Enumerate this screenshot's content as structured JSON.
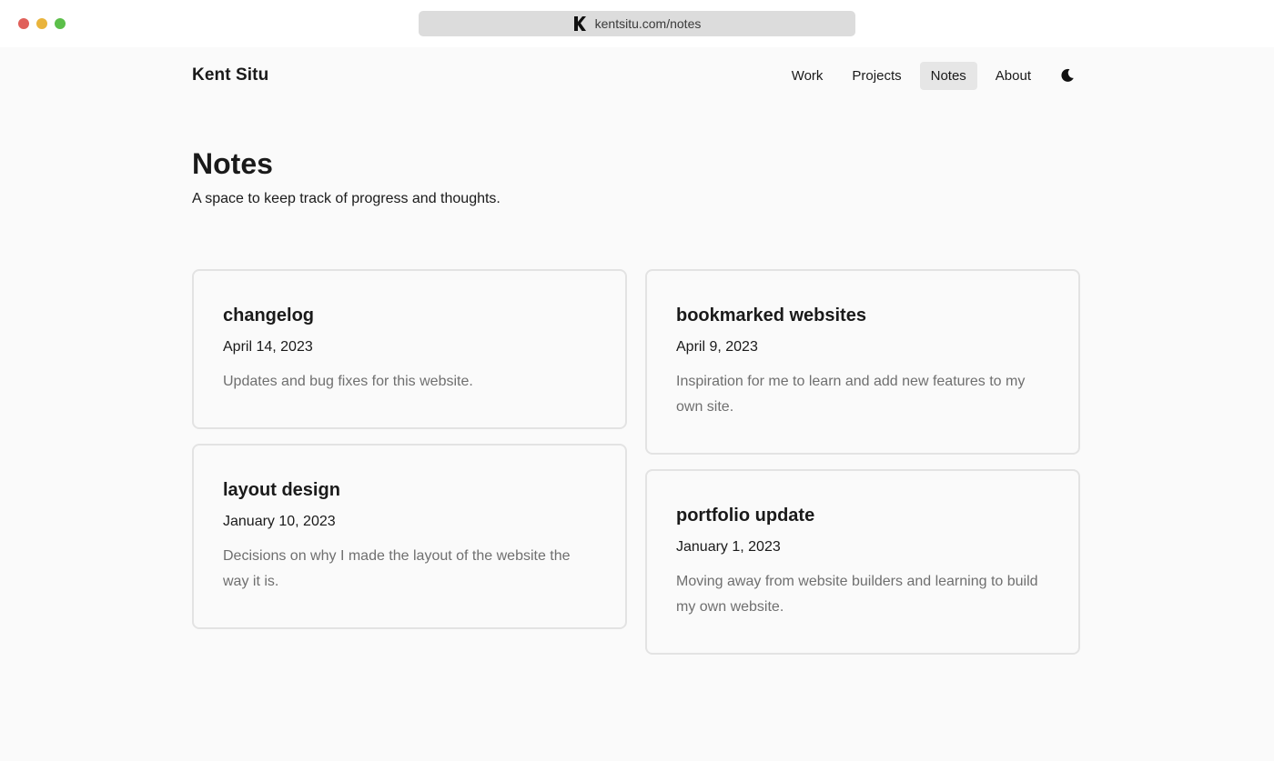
{
  "browser": {
    "url": "kentsitu.com/notes",
    "favicon_icon": "k-logo-icon"
  },
  "nav": {
    "brand": "Kent Situ",
    "links": [
      {
        "label": "Work",
        "active": false
      },
      {
        "label": "Projects",
        "active": false
      },
      {
        "label": "Notes",
        "active": true
      },
      {
        "label": "About",
        "active": false
      }
    ],
    "theme_toggle_icon": "moon-icon"
  },
  "header": {
    "title": "Notes",
    "subtitle": "A space to keep track of progress and thoughts."
  },
  "notes": [
    {
      "title": "changelog",
      "date": "April 14, 2023",
      "description": "Updates and bug fixes for this website."
    },
    {
      "title": "bookmarked websites",
      "date": "April 9, 2023",
      "description": "Inspiration for me to learn and add new features to my own site."
    },
    {
      "title": "layout design",
      "date": "January 10, 2023",
      "description": "Decisions on why I made the layout of the website the way it is."
    },
    {
      "title": "portfolio update",
      "date": "January 1, 2023",
      "description": "Moving away from website builders and learning to build my own website."
    }
  ],
  "colors": {
    "background": "#fafafa",
    "text": "#1a1a1a",
    "muted_text": "#6f6f6f",
    "card_border": "#e3e3e3",
    "active_nav_bg": "#e6e6e6"
  }
}
